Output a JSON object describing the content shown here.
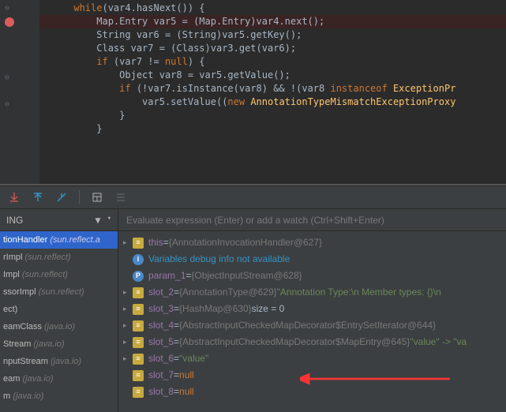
{
  "code": {
    "l1a": "      while",
    "l1b": "(var4.hasNext()) {",
    "l2": "          Map.Entry var5 = (Map.Entry)var4.next();",
    "l3": "          String var6 = (String)var5.getKey();",
    "l4": "          Class var7 = (Class)var3.get(var6);",
    "l5a": "          if ",
    "l5b": "(var7 != ",
    "l5c": "null",
    "l5d": ") {",
    "l6": "              Object var8 = var5.getValue();",
    "l7a": "              if ",
    "l7b": "(!var7.isInstance(var8) && !(var8 ",
    "l7c": "instanceof ",
    "l7d": "ExceptionPr",
    "l8a": "                  var5.setValue((",
    "l8b": "new ",
    "l8c": "AnnotationTypeMismatchExceptionProxy",
    "l9": "              }",
    "l10": "          }"
  },
  "frames": {
    "title": "ING",
    "items": [
      {
        "method": "tionHandler",
        "pkg": "(sun.reflect.a",
        "selected": true
      },
      {
        "method": "rImpl",
        "pkg": "(sun.reflect)"
      },
      {
        "method": "Impl",
        "pkg": "(sun.reflect)"
      },
      {
        "method": "ssorImpl",
        "pkg": "(sun.reflect)"
      },
      {
        "method": "ect)",
        "pkg": ""
      },
      {
        "method": "eamClass",
        "pkg": "(java.io)"
      },
      {
        "method": "Stream",
        "pkg": "(java.io)"
      },
      {
        "method": "nputStream",
        "pkg": "(java.io)"
      },
      {
        "method": "eam",
        "pkg": "(java.io)"
      },
      {
        "method": "m",
        "pkg": "(java.io)"
      }
    ]
  },
  "watch": {
    "placeholder": "Evaluate expression (Enter) or add a watch (Ctrl+Shift+Enter)"
  },
  "vars": {
    "info": "Variables debug info not available",
    "rows": [
      {
        "arrow": true,
        "icon": "f",
        "name": "this",
        "eq": " = ",
        "val": "{AnnotationInvocationHandler@627}"
      },
      {
        "arrow": false,
        "icon": "i",
        "info": true
      },
      {
        "arrow": false,
        "icon": "p",
        "name": "param_1",
        "eq": " = ",
        "val": "{ObjectInputStream@628}"
      },
      {
        "arrow": true,
        "icon": "f",
        "name": "slot_2",
        "eq": " = ",
        "val": "{AnnotationType@629}",
        "after": " \"Annotation Type:\\n   Member types: {}\\n "
      },
      {
        "arrow": true,
        "icon": "f",
        "name": "slot_3",
        "eq": " = ",
        "val": "{HashMap@630}",
        "after_plain": "  size = 0"
      },
      {
        "arrow": true,
        "icon": "f",
        "name": "slot_4",
        "eq": " = ",
        "val": "{AbstractInputCheckedMapDecorator$EntrySetIterator@644}"
      },
      {
        "arrow": true,
        "icon": "f",
        "name": "slot_5",
        "eq": " = ",
        "val": "{AbstractInputCheckedMapDecorator$MapEntry@645}",
        "after": " \"value\" -> \"va"
      },
      {
        "arrow": true,
        "icon": "f",
        "name": "slot_6",
        "eq": " = ",
        "str": "\"value\""
      },
      {
        "arrow": false,
        "icon": "f",
        "name": "slot_7",
        "eq": " = ",
        "kw": "null"
      },
      {
        "arrow": false,
        "icon": "f",
        "name": "slot_8",
        "eq": " = ",
        "kw": "null"
      }
    ]
  }
}
